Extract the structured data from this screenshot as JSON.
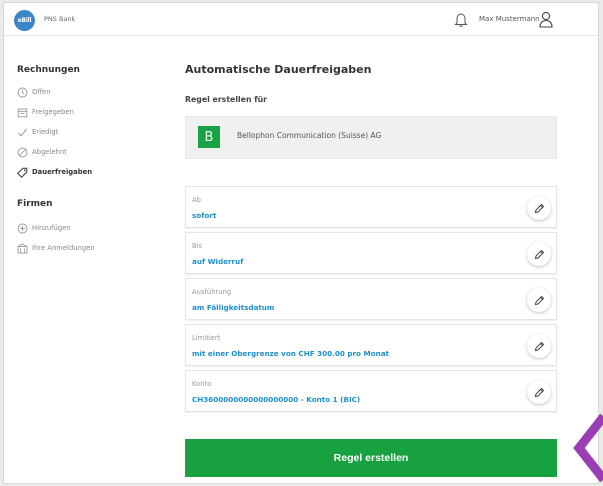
{
  "header": {
    "logo_text": "eBill",
    "bank_name": "PNS Bank",
    "username": "Max Mustermann"
  },
  "sidebar": {
    "section1_title": "Rechnungen",
    "section1_items": [
      {
        "label": "Offen",
        "icon": "clock-icon"
      },
      {
        "label": "Freigegeben",
        "icon": "calendar-icon"
      },
      {
        "label": "Erledigt",
        "icon": "check-icon"
      },
      {
        "label": "Abgelehnt",
        "icon": "prohibited-icon"
      },
      {
        "label": "Dauerfreigaben",
        "icon": "tag-icon",
        "active": true
      }
    ],
    "section2_title": "Firmen",
    "section2_items": [
      {
        "label": "Hinzufügen",
        "icon": "plus-circle-icon"
      },
      {
        "label": "Ihre Anmeldungen",
        "icon": "building-icon"
      }
    ]
  },
  "main": {
    "title": "Automatische Dauerfreigaben",
    "subtitle": "Regel erstellen für",
    "company": {
      "badge": "B",
      "name": "Bellophon Communication (Suisse) AG"
    },
    "rows": [
      {
        "label": "Ab",
        "value": "sofort"
      },
      {
        "label": "Bis",
        "value": "auf Widerruf"
      },
      {
        "label": "Ausführung",
        "value": "am Fälligkeitsdatum"
      },
      {
        "label": "Limitiert",
        "value": "mit einer Obergrenze von CHF 300.00 pro Monat"
      },
      {
        "label": "Konto",
        "value": "CH3600000000000000000 - Konto 1 (BIC)"
      }
    ],
    "cta_label": "Regel erstellen"
  },
  "colors": {
    "accent_green": "#18a140",
    "link_blue": "#1f8fc9",
    "logo_blue": "#3b86c6",
    "arrow_purple": "#9a3fb3"
  }
}
